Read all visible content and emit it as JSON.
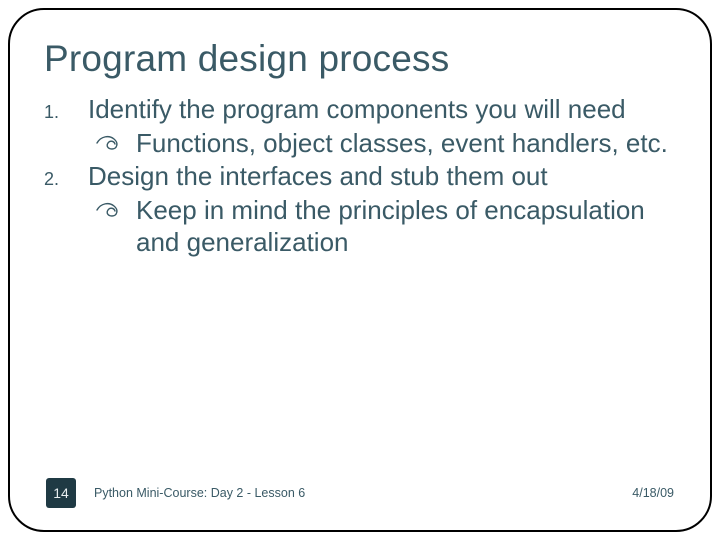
{
  "title": "Program design process",
  "items": [
    {
      "marker": "1.",
      "text": "Identify the program components you will need",
      "sub": "Functions, object classes, event handlers, etc."
    },
    {
      "marker": "2.",
      "text": "Design the interfaces and stub them out",
      "sub": "Keep in mind the principles of encapsulation and generalization"
    }
  ],
  "footer": {
    "page": "14",
    "course": "Python Mini-Course: Day 2 - Lesson 6",
    "date": "4/18/09"
  }
}
